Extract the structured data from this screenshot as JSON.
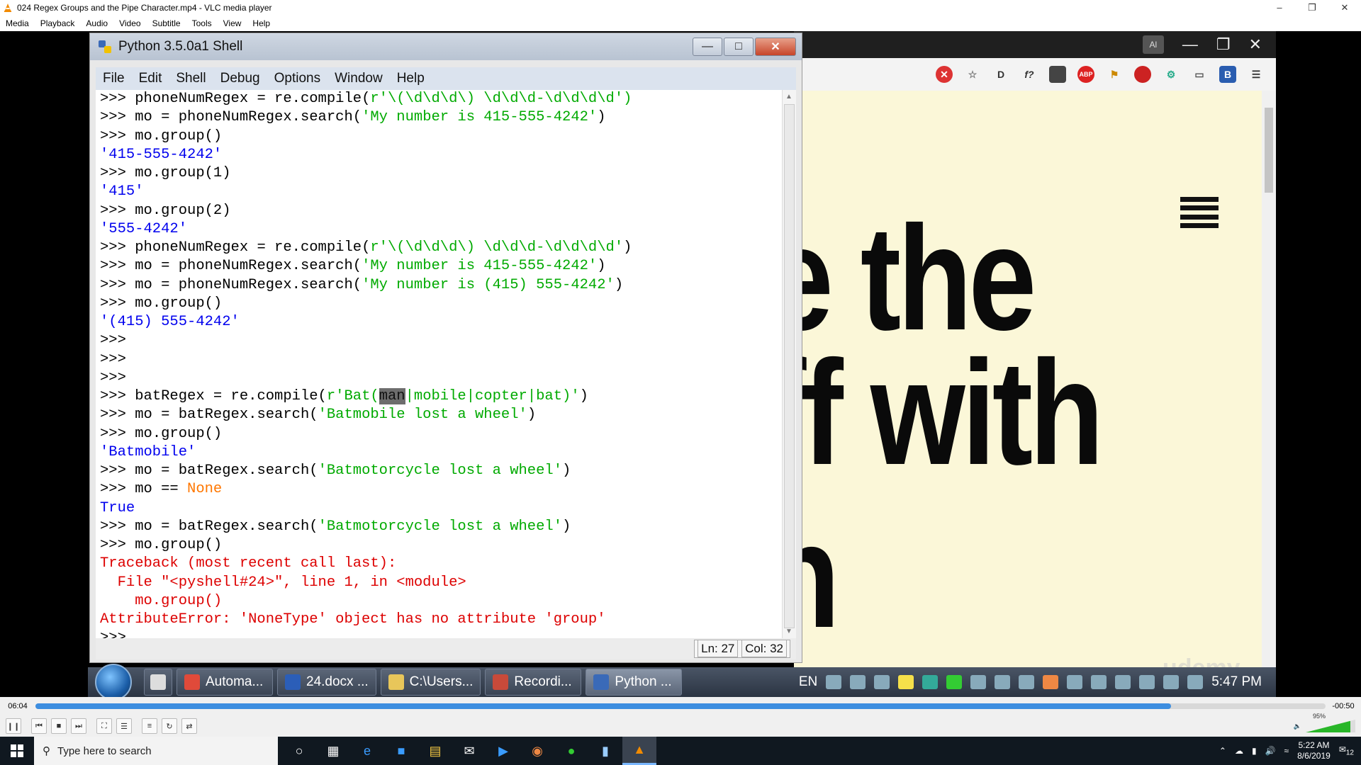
{
  "vlc": {
    "title": "024 Regex Groups and the Pipe Character.mp4 - VLC media player",
    "menu": [
      "Media",
      "Playback",
      "Audio",
      "Video",
      "Subtitle",
      "Tools",
      "View",
      "Help"
    ],
    "time_elapsed": "06:04",
    "time_remaining": "-00:50",
    "progress_fraction": 0.88,
    "volume": "95%"
  },
  "idle": {
    "title": "Python 3.5.0a1 Shell",
    "menu": [
      "File",
      "Edit",
      "Shell",
      "Debug",
      "Options",
      "Window",
      "Help"
    ],
    "status_ln": "Ln: 27",
    "status_col": "Col: 32",
    "lines": [
      [
        [
          "prompt",
          ">>> "
        ],
        [
          "kw",
          "phoneNumRegex = re.compile("
        ],
        [
          "str",
          "r'\\(\\d\\d\\d\\) \\d\\d\\d-\\d\\d\\d\\d')"
        ]
      ],
      [
        [
          "prompt",
          ">>> "
        ],
        [
          "kw",
          "mo = phoneNumRegex.search("
        ],
        [
          "str",
          "'My number is 415-555-4242'"
        ],
        [
          "kw",
          ")"
        ]
      ],
      [
        [
          "prompt",
          ">>> "
        ],
        [
          "kw",
          "mo.group()"
        ]
      ],
      [
        [
          "out",
          "'415-555-4242'"
        ]
      ],
      [
        [
          "prompt",
          ">>> "
        ],
        [
          "kw",
          "mo.group(1)"
        ]
      ],
      [
        [
          "out",
          "'415'"
        ]
      ],
      [
        [
          "prompt",
          ">>> "
        ],
        [
          "kw",
          "mo.group(2)"
        ]
      ],
      [
        [
          "out",
          "'555-4242'"
        ]
      ],
      [
        [
          "prompt",
          ">>> "
        ],
        [
          "kw",
          "phoneNumRegex = re.compile("
        ],
        [
          "str",
          "r'\\(\\d\\d\\d\\) \\d\\d\\d-\\d\\d\\d\\d'"
        ],
        [
          "kw",
          ")"
        ]
      ],
      [
        [
          "prompt",
          ">>> "
        ],
        [
          "kw",
          "mo = phoneNumRegex.search("
        ],
        [
          "str",
          "'My number is 415-555-4242'"
        ],
        [
          "kw",
          ")"
        ]
      ],
      [
        [
          "prompt",
          ">>> "
        ],
        [
          "kw",
          "mo = phoneNumRegex.search("
        ],
        [
          "str",
          "'My number is (415) 555-4242'"
        ],
        [
          "kw",
          ")"
        ]
      ],
      [
        [
          "prompt",
          ">>> "
        ],
        [
          "kw",
          "mo.group()"
        ]
      ],
      [
        [
          "out",
          "'(415) 555-4242'"
        ]
      ],
      [
        [
          "prompt",
          ">>>"
        ]
      ],
      [
        [
          "prompt",
          ">>>"
        ]
      ],
      [
        [
          "prompt",
          ">>>"
        ]
      ],
      [
        [
          "prompt",
          ">>> "
        ],
        [
          "kw",
          "batRegex = re.compile("
        ],
        [
          "str",
          "r'Bat("
        ],
        [
          "sel",
          "man"
        ],
        [
          "str",
          "|mobile|copter|bat)'"
        ],
        [
          "kw",
          ")"
        ]
      ],
      [
        [
          "prompt",
          ">>> "
        ],
        [
          "kw",
          "mo = batRegex.search("
        ],
        [
          "str",
          "'Batmobile lost a wheel'"
        ],
        [
          "kw",
          ")"
        ]
      ],
      [
        [
          "prompt",
          ">>> "
        ],
        [
          "kw",
          "mo.group()"
        ]
      ],
      [
        [
          "out",
          "'Batmobile'"
        ]
      ],
      [
        [
          "prompt",
          ">>> "
        ],
        [
          "kw",
          "mo = batRegex.search("
        ],
        [
          "str",
          "'Batmotorcycle lost a wheel'"
        ],
        [
          "kw",
          ")"
        ]
      ],
      [
        [
          "prompt",
          ">>> "
        ],
        [
          "kw",
          "mo == "
        ],
        [
          "none",
          "None"
        ]
      ],
      [
        [
          "out",
          "True"
        ]
      ],
      [
        [
          "prompt",
          ">>> "
        ],
        [
          "kw",
          "mo = batRegex.search("
        ],
        [
          "str",
          "'Batmotorcycle lost a wheel'"
        ],
        [
          "kw",
          ")"
        ]
      ],
      [
        [
          "prompt",
          ">>> "
        ],
        [
          "kw",
          "mo.group()"
        ]
      ],
      [
        [
          "err",
          "Traceback (most recent call last):"
        ]
      ],
      [
        [
          "err",
          "  File \"<pyshell#24>\", line 1, in <module>"
        ]
      ],
      [
        [
          "err",
          "    mo.group()"
        ]
      ],
      [
        [
          "err",
          "AttributeError: 'NoneType' object has no attribute 'group'"
        ]
      ],
      [
        [
          "prompt",
          ">>>"
        ]
      ]
    ]
  },
  "browser": {
    "hero_lines": [
      "e the",
      "ff with",
      "n"
    ],
    "avatar": "Al",
    "watermark": "udemy"
  },
  "inner_taskbar": {
    "tasks": [
      {
        "label": "Automa...",
        "color": "#e04a3a"
      },
      {
        "label": "24.docx ...",
        "color": "#2b5eb8"
      },
      {
        "label": "C:\\Users...",
        "color": "#e8c65a"
      },
      {
        "label": "Recordi...",
        "color": "#c84a3a"
      },
      {
        "label": "Python ...",
        "color": "#3a6ab8",
        "active": true
      }
    ],
    "lang": "EN",
    "time": "5:47 PM"
  },
  "win10": {
    "search_placeholder": "Type here to search",
    "time": "5:22 AM",
    "date": "8/6/2019",
    "notifications": "12"
  }
}
